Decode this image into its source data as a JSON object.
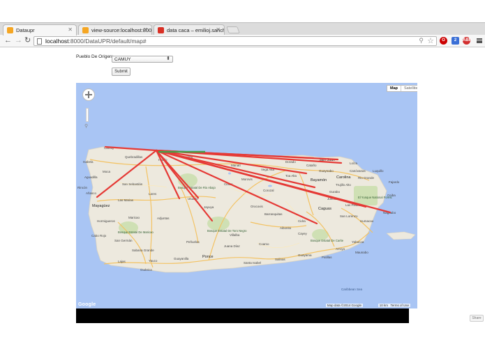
{
  "browser": {
    "tabs": [
      {
        "title": "Dataupr",
        "active": true
      },
      {
        "title": "view-source:localhost:800",
        "active": false
      },
      {
        "title": "data caca – emilioj.sanche",
        "active": false
      }
    ],
    "address": {
      "host": "localhost",
      "path": ":8000/DataUPR/default/map#"
    },
    "ext_badges": [
      "O",
      "2",
      "ABP"
    ]
  },
  "form": {
    "label": "Pueblo De Origen:",
    "select_value": "CAMUY",
    "submit_label": "Submit"
  },
  "map": {
    "type_buttons": [
      "Map",
      "Satellite"
    ],
    "attribution": {
      "data": "Map data ©2014 Google",
      "scale": "10 km",
      "terms": "Terms of Use",
      "logo": "Google"
    },
    "places": {
      "camuy": "Camuy",
      "arecibo": "Arecibo",
      "san_juan": "San Juan",
      "vega_alta": "Vega Alta",
      "manati": "Manatí",
      "bayamon": "Bayamón",
      "carolina": "Carolina",
      "rio_grande": "Rio Grande",
      "aguadilla": "Aguadilla",
      "mayaguez": "Mayagüez",
      "ponce": "Ponce",
      "caguas": "Caguas",
      "cayey": "Cayey",
      "guayama": "Guayama",
      "humacao": "Humacao",
      "naguabo": "Naguabo",
      "yauco": "Yauco",
      "cabo_rojo": "Cabo Rojo",
      "san_german": "San Germán",
      "lares": "Lares",
      "utuado": "Utuado",
      "adjuntas": "Adjuntas",
      "jayuya": "Jayuya",
      "orocovis": "Orocovis",
      "corozal": "Corozal",
      "cidra": "Cidra",
      "coamo": "Coamo",
      "juana_diaz": "Juana Díaz",
      "santa_isabel": "Santa Isabel",
      "salinas": "Salinas",
      "yabucoa": "Yabucoa",
      "patillas": "Patillas",
      "maunabo": "Maunabo",
      "san_lorenzo": "San Lorenzo",
      "las_piedras": "Las Piedras",
      "guayanilla": "Guayanilla",
      "sabana_grande": "Sabana Grande",
      "hormigueros": "Hormigueros",
      "maricao": "Maricao",
      "las_marias": "Las Marias",
      "san_sebastian": "San Sebastián",
      "moca": "Moca",
      "isabela": "Isabela",
      "quebradillas": "Quebradillas",
      "hatillo": "Hatillo",
      "morovis": "Morovis",
      "ciales": "Ciales",
      "barranquitas": "Barranquitas",
      "aibonito": "Aibonito",
      "toa_alta": "Toa Alta",
      "dorado": "Dorado",
      "catano": "Cataño",
      "guaynabo": "Guaynabo",
      "trujillo_alto": "Trujillo Alto",
      "canovanas": "Canóvanas",
      "loiza": "Loíza",
      "luquillo": "Luquillo",
      "fajardo": "Fajardo",
      "ceiba": "Ceiba",
      "juncos": "Juncos",
      "gurabo": "Gurabo",
      "arroyo": "Arroyo",
      "villalba": "Villalba",
      "penuelas": "Peñuelas",
      "guanica": "Guánica",
      "lajas": "Lajas",
      "afasco": "Añasco",
      "rincon": "Rincón"
    },
    "parks": {
      "yunque": "El Yunque National Forest",
      "rio_abajo": "Bosque Estatal De Rio Abajo",
      "toro_negro": "Bosque Estatal De Toro Negro",
      "maricao_forest": "Bosque Estatal De Maricao",
      "carite": "Bosque Estatal De Carite"
    },
    "sea_label": "Caribbean Sea",
    "route_color": "#e53935",
    "origin_color": "#43a047"
  },
  "share_label": "Share"
}
